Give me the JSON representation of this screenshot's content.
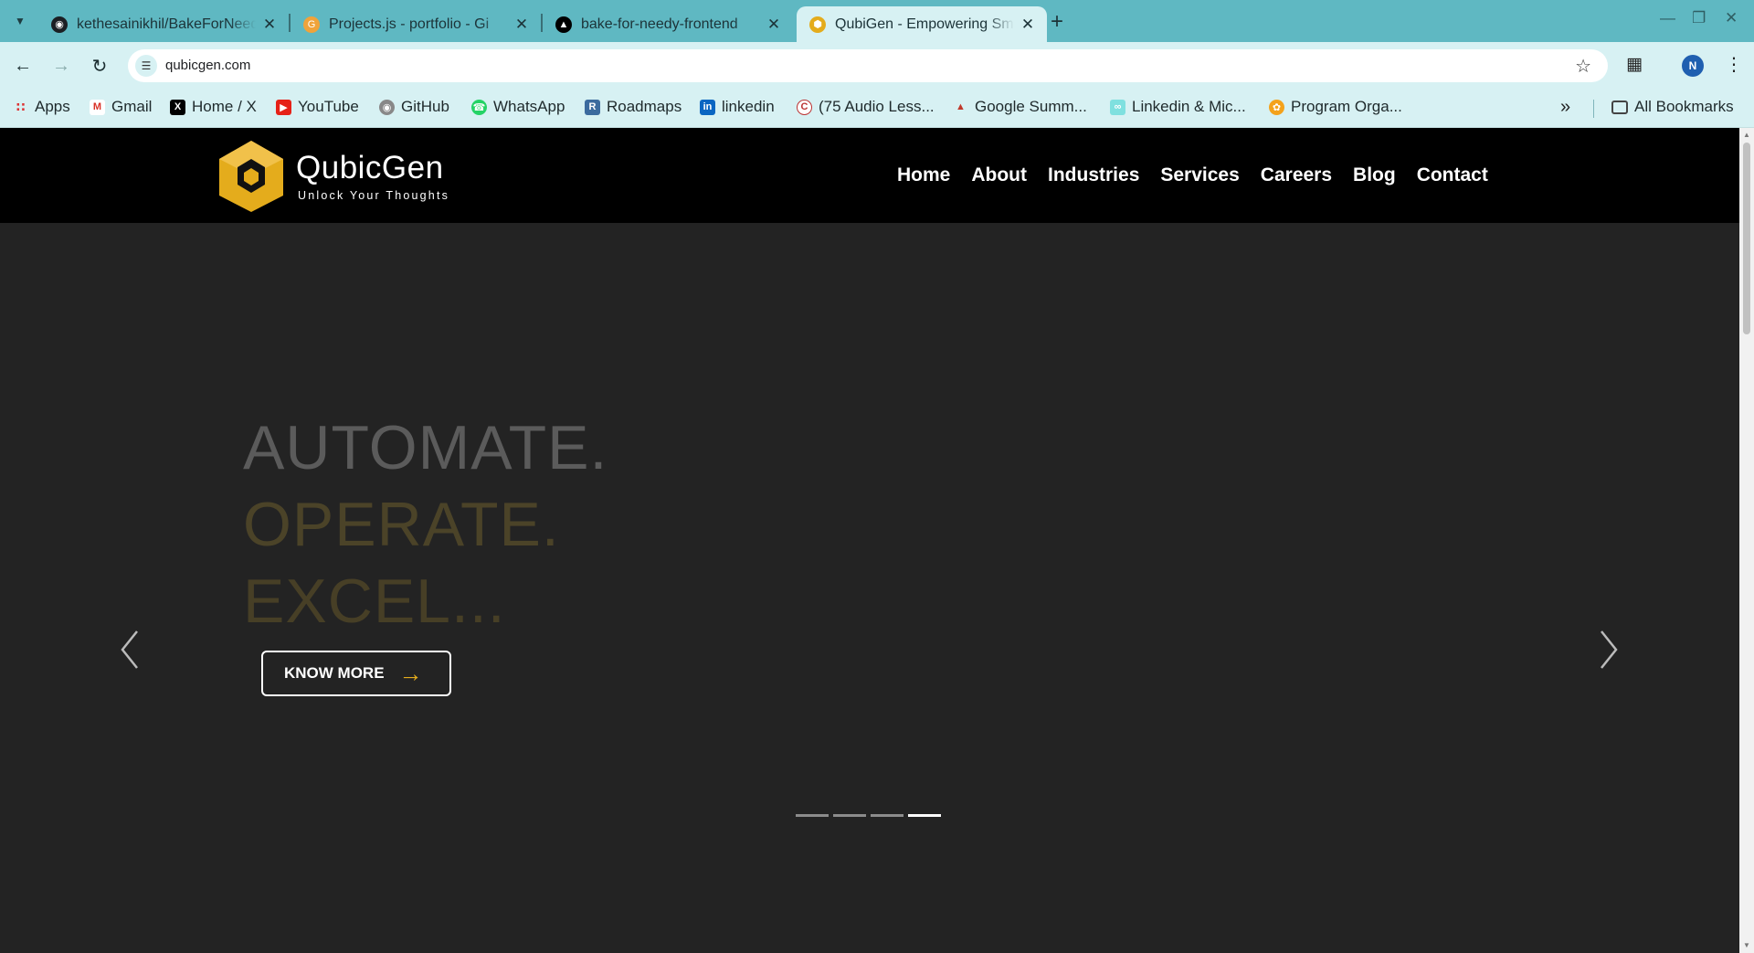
{
  "browser": {
    "tabs": [
      {
        "title": "kethesainikhil/BakeForNeedy",
        "favicon": "github-icon",
        "active": false
      },
      {
        "title": "Projects.js - portfolio - Gi",
        "favicon": "gitpod-icon",
        "active": false
      },
      {
        "title": "bake-for-needy-frontend",
        "favicon": "vercel-icon",
        "active": false
      },
      {
        "title": "QubiGen - Empowering Smart",
        "favicon": "qubicgen-icon",
        "active": true
      }
    ],
    "url": "qubicgen.com",
    "profile_initial": "N",
    "bookmarks": [
      {
        "label": "Apps",
        "icon": "apps-grid-icon"
      },
      {
        "label": "Gmail",
        "icon": "gmail-icon"
      },
      {
        "label": "Home / X",
        "icon": "x-icon"
      },
      {
        "label": "YouTube",
        "icon": "youtube-icon"
      },
      {
        "label": "GitHub",
        "icon": "github-icon"
      },
      {
        "label": "WhatsApp",
        "icon": "whatsapp-icon"
      },
      {
        "label": "Roadmaps",
        "icon": "roadmaps-icon"
      },
      {
        "label": "linkedin",
        "icon": "linkedin-icon"
      },
      {
        "label": "(75 Audio Less...",
        "icon": "audio-icon"
      },
      {
        "label": "Google Summ...",
        "icon": "google-summer-icon"
      },
      {
        "label": "Linkedin & Mic...",
        "icon": "linkedin-mic-icon"
      },
      {
        "label": "Program Orga...",
        "icon": "program-icon"
      }
    ],
    "all_bookmarks_label": "All Bookmarks"
  },
  "site": {
    "brand_name": "QubicGen",
    "tagline": "Unlock Your Thoughts",
    "nav": [
      "Home",
      "About",
      "Industries",
      "Services",
      "Careers",
      "Blog",
      "Contact"
    ],
    "hero": {
      "line1": "AUTOMATE.",
      "line2": "OPERATE.",
      "line3": "EXCEL...",
      "cta_label": "KNOW MORE",
      "slide_count": 4,
      "active_slide": 4
    }
  },
  "colors": {
    "accent": "#e4ac1c",
    "header_bg": "#000000",
    "hero_bg": "#232323",
    "tab_strip": "#5fb8c2",
    "toolbar": "#d7f1f3"
  }
}
